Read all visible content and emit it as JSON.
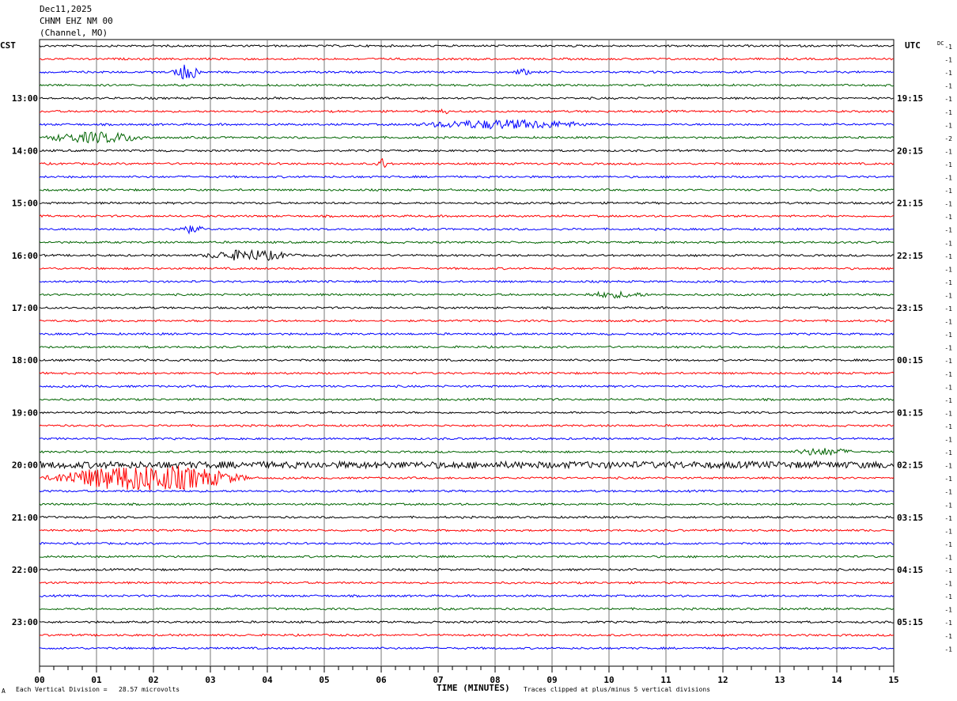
{
  "header": {
    "date": "Dec11,2025",
    "station": "CHNM EHZ NM 00",
    "location": "(Channel, MO)"
  },
  "chart_data": {
    "type": "seismogram",
    "left_timezone": "CST",
    "right_timezone": "UTC",
    "right_scale_header": "DC",
    "left_hour_labels": [
      "13:00",
      "14:00",
      "15:00",
      "16:00",
      "17:00",
      "18:00",
      "19:00",
      "20:00",
      "21:00",
      "22:00",
      "23:00"
    ],
    "right_hour_labels": [
      "19:15",
      "20:15",
      "21:15",
      "22:15",
      "23:15",
      "00:15",
      "01:15",
      "02:15",
      "03:15",
      "04:15",
      "05:15"
    ],
    "x_tick_labels": [
      "00",
      "01",
      "02",
      "03",
      "04",
      "05",
      "06",
      "07",
      "08",
      "09",
      "10",
      "11",
      "12",
      "13",
      "14",
      "15"
    ],
    "xlabel": "TIME (MINUTES)",
    "trace_count": 47,
    "trace_color_cycle": [
      "#000000",
      "#ff0000",
      "#0000ff",
      "#006400"
    ],
    "trace_offsets": [
      -1,
      -1,
      -1,
      -1,
      -1,
      -1,
      -1,
      -2,
      -1,
      -1,
      -1,
      -1,
      -1,
      -1,
      -1,
      -1,
      -1,
      -1,
      -1,
      -1,
      -1,
      -1,
      -1,
      -1,
      -1,
      -1,
      -1,
      -1,
      -1,
      -1,
      -1,
      -1,
      -1,
      -1,
      -1,
      -1,
      -1,
      -1,
      -1,
      -1,
      -1,
      -1,
      -1,
      -1,
      -1,
      -1,
      -1
    ],
    "events": [
      {
        "trace": 2,
        "start_min": 2.3,
        "end_min": 3.2,
        "amp": 9
      },
      {
        "trace": 2,
        "start_min": 8.3,
        "end_min": 8.9,
        "amp": 3
      },
      {
        "trace": 6,
        "start_min": 6.5,
        "end_min": 11.8,
        "amp": 5
      },
      {
        "trace": 7,
        "start_min": 0.0,
        "end_min": 3.2,
        "amp": 6
      },
      {
        "trace": 5,
        "start_min": 7.0,
        "end_min": 7.3,
        "amp": 4
      },
      {
        "trace": 9,
        "start_min": 5.9,
        "end_min": 6.3,
        "amp": 6
      },
      {
        "trace": 14,
        "start_min": 2.3,
        "end_min": 3.3,
        "amp": 4
      },
      {
        "trace": 16,
        "start_min": 2.8,
        "end_min": 5.6,
        "amp": 6
      },
      {
        "trace": 19,
        "start_min": 9.5,
        "end_min": 11.5,
        "amp": 3
      },
      {
        "trace": 31,
        "start_min": 13.2,
        "end_min": 15.0,
        "amp": 4
      },
      {
        "trace": 32,
        "start_min": 0.0,
        "end_min": 15.0,
        "amp": 3
      },
      {
        "trace": 33,
        "start_min": 0.0,
        "end_min": 6.0,
        "amp": 16
      }
    ]
  },
  "footer": {
    "left_mark": "A",
    "scale_note": "Each Vertical Division =   28.57 microvolts",
    "clip_note": "Traces clipped at plus/minus 5 vertical divisions"
  }
}
